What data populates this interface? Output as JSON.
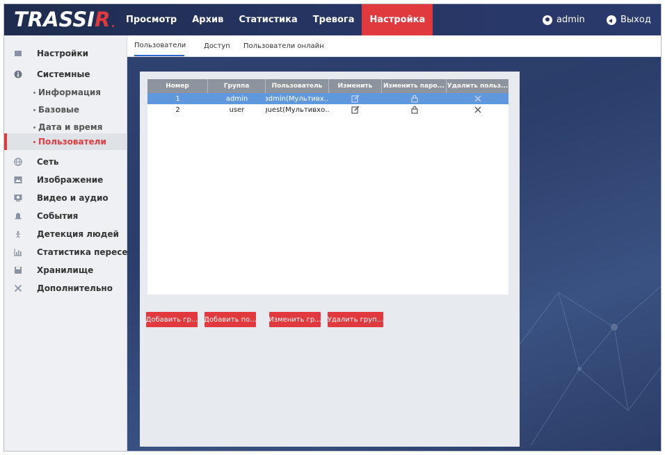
{
  "header": {
    "logo_text": "TRASSI",
    "logo_r": "R",
    "logo_dot": ".",
    "nav": [
      {
        "label": "Просмотр"
      },
      {
        "label": "Архив"
      },
      {
        "label": "Статистика"
      },
      {
        "label": "Тревога"
      },
      {
        "label": "Настройка",
        "active": true
      }
    ],
    "user": "admin",
    "logout": "Выход"
  },
  "sidebar": {
    "items": [
      {
        "label": "Настройки",
        "icon": "settings-icon"
      },
      {
        "label": "Системные",
        "icon": "info-icon"
      },
      {
        "label": "Информация",
        "sub": true
      },
      {
        "label": "Базовые",
        "sub": true
      },
      {
        "label": "Дата и время",
        "sub": true
      },
      {
        "label": "Пользователи",
        "sub": true,
        "selected": true
      },
      {
        "label": "Сеть",
        "icon": "globe-icon"
      },
      {
        "label": "Изображение",
        "icon": "image-icon"
      },
      {
        "label": "Видео и аудио",
        "icon": "video-icon"
      },
      {
        "label": "События",
        "icon": "bell-icon"
      },
      {
        "label": "Детекция людей",
        "icon": "people-detection-icon"
      },
      {
        "label": "Статистика пересе...",
        "icon": "stats-chart-icon"
      },
      {
        "label": "Хранилище",
        "icon": "storage-icon"
      },
      {
        "label": "Дополнительно",
        "icon": "tools-icon"
      }
    ]
  },
  "subtabs": [
    {
      "label": "Пользователи",
      "active": true
    },
    {
      "label": "Доступ"
    },
    {
      "label": "Пользователи онлайн"
    }
  ],
  "table": {
    "headers": [
      "Номер",
      "Группа",
      "Пользователь",
      "Изменить",
      "Изменить паро...",
      "Удалить польз..."
    ],
    "rows": [
      {
        "num": "1",
        "group": "admin",
        "user": "admin(Мультивх...",
        "selected": true
      },
      {
        "num": "2",
        "group": "user",
        "user": "guest(Мультивхо..."
      }
    ]
  },
  "buttons": [
    "Добавить гр...",
    "Добавить по...",
    "Изменить гр...",
    "Удалить груп..."
  ],
  "colors": {
    "accent": "#e03a3e",
    "header_bg": "#263563",
    "selected_row": "#5f98dc"
  }
}
